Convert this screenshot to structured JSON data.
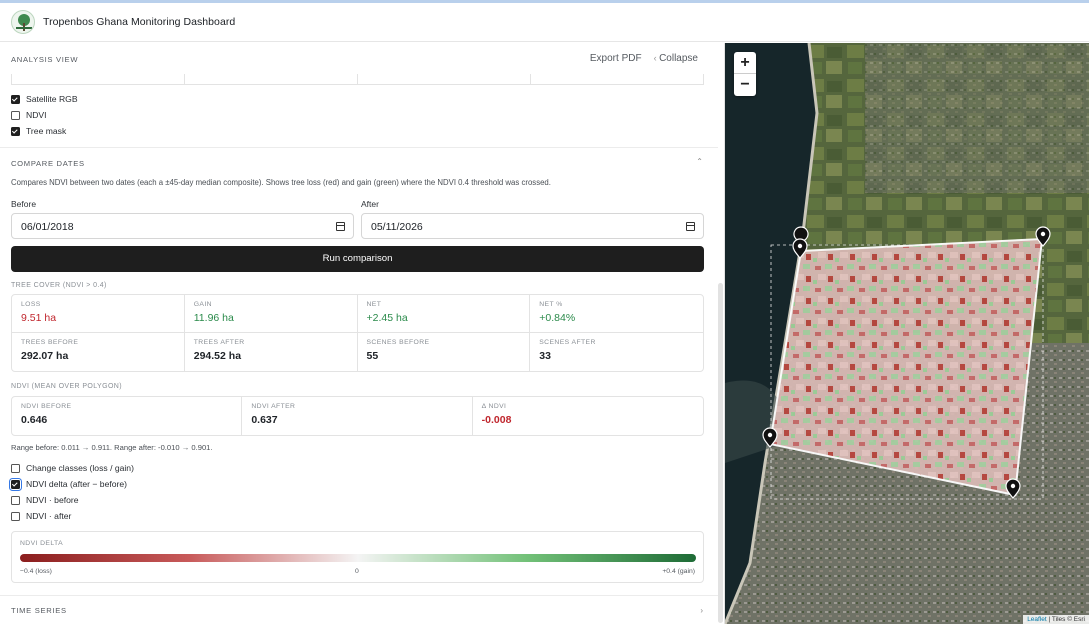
{
  "app": {
    "title": "Tropenbos Ghana Monitoring Dashboard",
    "logo_icon": "tree-logo-icon"
  },
  "analysis": {
    "heading": "ANALYSIS VIEW",
    "export_label": "Export PDF",
    "collapse_label": "Collapse"
  },
  "layers": [
    {
      "label": "Satellite RGB",
      "checked": true
    },
    {
      "label": "NDVI",
      "checked": false
    },
    {
      "label": "Tree mask",
      "checked": true
    }
  ],
  "compare": {
    "heading": "COMPARE DATES",
    "description": "Compares NDVI between two dates (each a ±45-day median composite). Shows tree loss (red) and gain (green) where the NDVI 0.4 threshold was crossed.",
    "before_label": "Before",
    "before_value": "06/01/2018",
    "after_label": "After",
    "after_value": "05/11/2026",
    "run_label": "Run comparison"
  },
  "tree_cover": {
    "heading": "TREE COVER (NDVI > 0.4)",
    "loss_label": "LOSS",
    "loss_value": "9.51 ha",
    "gain_label": "GAIN",
    "gain_value": "11.96 ha",
    "net_label": "NET",
    "net_value": "+2.45 ha",
    "netpct_label": "NET %",
    "netpct_value": "+0.84%",
    "trees_before_label": "TREES BEFORE",
    "trees_before_value": "292.07 ha",
    "trees_after_label": "TREES AFTER",
    "trees_after_value": "294.52 ha",
    "scenes_before_label": "SCENES BEFORE",
    "scenes_before_value": "55",
    "scenes_after_label": "SCENES AFTER",
    "scenes_after_value": "33"
  },
  "ndvi_mean": {
    "heading": "NDVI (MEAN OVER POLYGON)",
    "before_label": "NDVI BEFORE",
    "before_value": "0.646",
    "after_label": "NDVI AFTER",
    "after_value": "0.637",
    "delta_label": "Δ NDVI",
    "delta_value": "-0.008",
    "range_note": "Range before: 0.011 → 0.911. Range after: -0.010 → 0.901."
  },
  "change_layers": [
    {
      "label": "Change classes (loss / gain)",
      "checked": false
    },
    {
      "label": "NDVI delta (after − before)",
      "checked": true
    },
    {
      "label": "NDVI · before",
      "checked": false
    },
    {
      "label": "NDVI · after",
      "checked": false
    }
  ],
  "legend": {
    "title": "NDVI DELTA",
    "min_label": "−0.4 (loss)",
    "mid_label": "0",
    "max_label": "+0.4 (gain)"
  },
  "time_series": {
    "heading": "TIME SERIES"
  },
  "map": {
    "zoom_in": "+",
    "zoom_out": "−",
    "attribution_leaflet": "Leaflet",
    "attribution_tiles": "| Tiles © Esri",
    "colors": {
      "loss": "#c0262d",
      "gain": "#2a8a4a"
    }
  }
}
